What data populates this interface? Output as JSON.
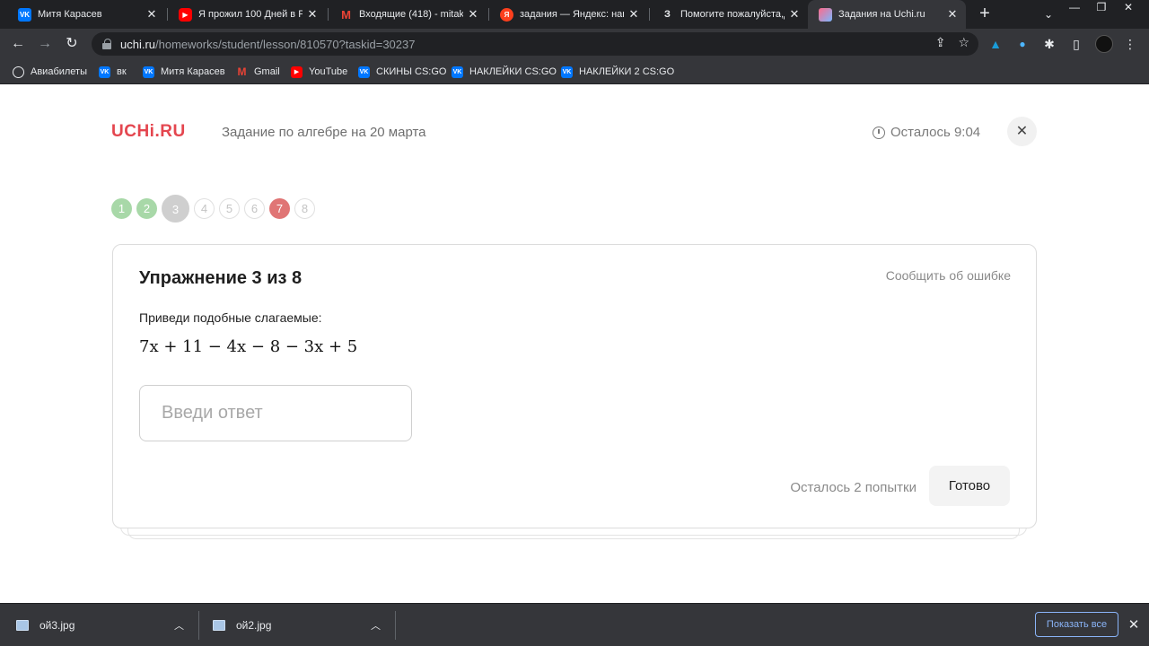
{
  "tabs": [
    {
      "title": "Митя Карасев",
      "icon": "vk-icon"
    },
    {
      "title": "Я прожил 100 Дней в Реа",
      "icon": "youtube-icon"
    },
    {
      "title": "Входящие (418) - mitakfr",
      "icon": "gmail-icon"
    },
    {
      "title": "задания — Яндекс: наш",
      "icon": "yandex-icon"
    },
    {
      "title": "Помогите пожалуйста,да",
      "icon": "znanija-icon",
      "glyph": "З"
    },
    {
      "title": "Задания на Uchi.ru",
      "icon": "uchi-icon",
      "active": true
    }
  ],
  "address": {
    "host": "uchi.ru",
    "path": "/homeworks/student/lesson/810570?taskid=30237"
  },
  "bookmarks": [
    {
      "label": "Авиабилеты",
      "icon": "globe-icon"
    },
    {
      "label": "вк",
      "icon": "vk-icon"
    },
    {
      "label": "Митя Карасев",
      "icon": "vk-icon"
    },
    {
      "label": "Gmail",
      "icon": "gmail-icon"
    },
    {
      "label": "YouTube",
      "icon": "youtube-icon"
    },
    {
      "label": "СКИНЫ CS:GO",
      "icon": "vk-icon"
    },
    {
      "label": "НАКЛЕЙКИ CS:GO",
      "icon": "vk-icon"
    },
    {
      "label": "НАКЛЕЙКИ 2 CS:GO",
      "icon": "vk-icon"
    }
  ],
  "header": {
    "logo": "UCHi.RU",
    "lesson_title": "Задание по алгебре на 20 марта",
    "timer_text": "Осталось 9:04"
  },
  "steps": [
    {
      "label": "1",
      "state": "done"
    },
    {
      "label": "2",
      "state": "done"
    },
    {
      "label": "3",
      "state": "current"
    },
    {
      "label": "4",
      "state": "pending"
    },
    {
      "label": "5",
      "state": "pending"
    },
    {
      "label": "6",
      "state": "pending"
    },
    {
      "label": "7",
      "state": "wrong"
    },
    {
      "label": "8",
      "state": "pending"
    }
  ],
  "exercise": {
    "title": "Упражнение 3 из 8",
    "report_label": "Сообщить об ошибке",
    "instruction": "Приведи подобные слагаемые:",
    "formula": "7x + 11 − 4x − 8 − 3x + 5",
    "answer_placeholder": "Введи ответ",
    "answer_value": "",
    "attempts_text": "Осталось 2 попытки",
    "submit_label": "Готово"
  },
  "downloads": {
    "files": [
      "ой3.jpg",
      "ой2.jpg"
    ],
    "show_all_label": "Показать все"
  },
  "colors": {
    "brand": "#e4464f",
    "step_done": "#a8d8a8",
    "step_wrong": "#e07575",
    "step_current": "#cfcfcf"
  }
}
